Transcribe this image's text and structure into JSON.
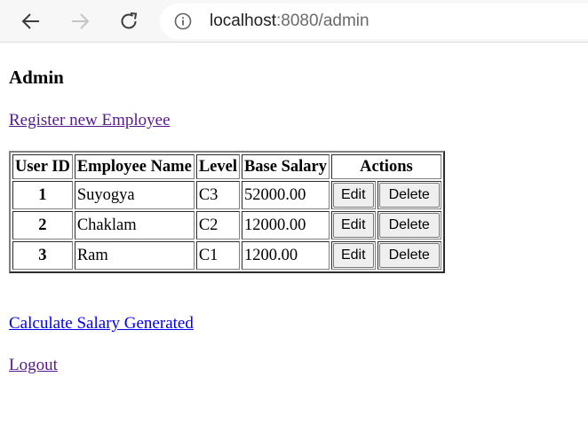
{
  "browser": {
    "url_host": "localhost",
    "url_rest": ":8080/admin"
  },
  "page": {
    "title": "Admin",
    "register_link": "Register new Employee",
    "calculate_link": "Calculate Salary Generated",
    "logout_link": "Logout"
  },
  "table": {
    "headers": [
      "User ID",
      "Employee Name",
      "Level",
      "Base Salary",
      "Actions"
    ],
    "rows": [
      {
        "id": "1",
        "name": "Suyogya",
        "level": "C3",
        "salary": "52000.00"
      },
      {
        "id": "2",
        "name": "Chaklam",
        "level": "C2",
        "salary": "12000.00"
      },
      {
        "id": "3",
        "name": "Ram",
        "level": "C1",
        "salary": "1200.00"
      }
    ],
    "edit_label": "Edit",
    "delete_label": "Delete"
  },
  "colors": {
    "visited_link": "#551a8b",
    "unvisited_link": "#0000ee"
  }
}
